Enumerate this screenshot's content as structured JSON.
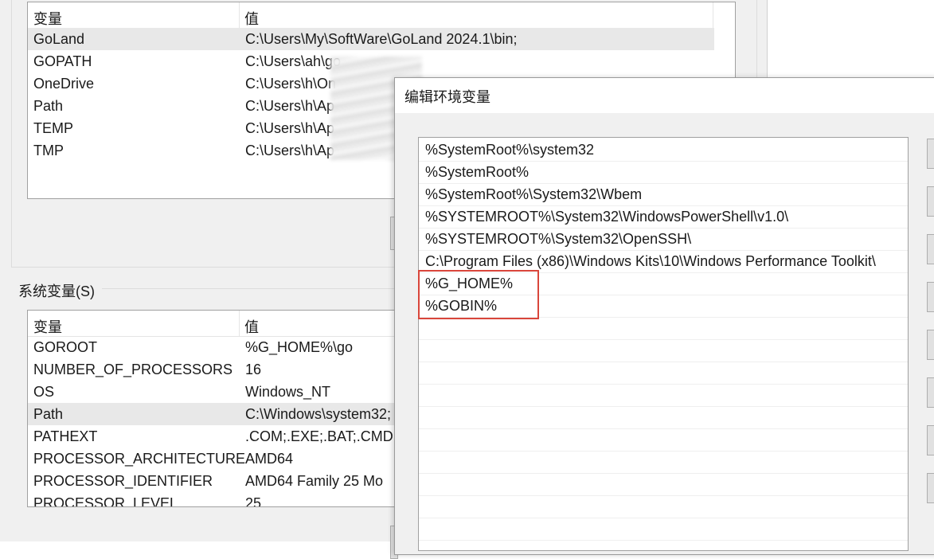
{
  "env_dialog": {
    "user_vars": {
      "headers": {
        "name": "变量",
        "value": "值"
      },
      "rows": [
        {
          "name": "GoLand",
          "value": "C:\\Users\\My\\SoftWare\\GoLand 2024.1\\bin;",
          "selected": true
        },
        {
          "name": "GOPATH",
          "value": "C:\\Users\\ah\\go"
        },
        {
          "name": "OneDrive",
          "value": "C:\\Users\\h\\On"
        },
        {
          "name": "Path",
          "value": "C:\\Users\\h\\Ap"
        },
        {
          "name": "TEMP",
          "value": "C:\\Users\\h\\Ap"
        },
        {
          "name": "TMP",
          "value": "C:\\Users\\h\\Ap"
        }
      ]
    },
    "system_vars": {
      "label": "系统变量(S)",
      "headers": {
        "name": "变量",
        "value": "值"
      },
      "rows": [
        {
          "name": "GOROOT",
          "value": "%G_HOME%\\go"
        },
        {
          "name": "NUMBER_OF_PROCESSORS",
          "value": "16"
        },
        {
          "name": "OS",
          "value": "Windows_NT"
        },
        {
          "name": "Path",
          "value": "C:\\Windows\\system32;",
          "selected": true
        },
        {
          "name": "PATHEXT",
          "value": ".COM;.EXE;.BAT;.CMD;"
        },
        {
          "name": "PROCESSOR_ARCHITECTURE",
          "value": "AMD64"
        },
        {
          "name": "PROCESSOR_IDENTIFIER",
          "value": "AMD64 Family 25 Mo"
        },
        {
          "name": "PROCESSOR_LEVEL",
          "value": "25"
        }
      ]
    }
  },
  "edit_dialog": {
    "title": "编辑环境变量",
    "paths": [
      "%SystemRoot%\\system32",
      "%SystemRoot%",
      "%SystemRoot%\\System32\\Wbem",
      "%SYSTEMROOT%\\System32\\WindowsPowerShell\\v1.0\\",
      "%SYSTEMROOT%\\System32\\OpenSSH\\",
      "C:\\Program Files (x86)\\Windows Kits\\10\\Windows Performance Toolkit\\",
      "%G_HOME%",
      "%GOBIN%"
    ],
    "empty_rows": 10,
    "highlight_color": "#d9463b"
  }
}
